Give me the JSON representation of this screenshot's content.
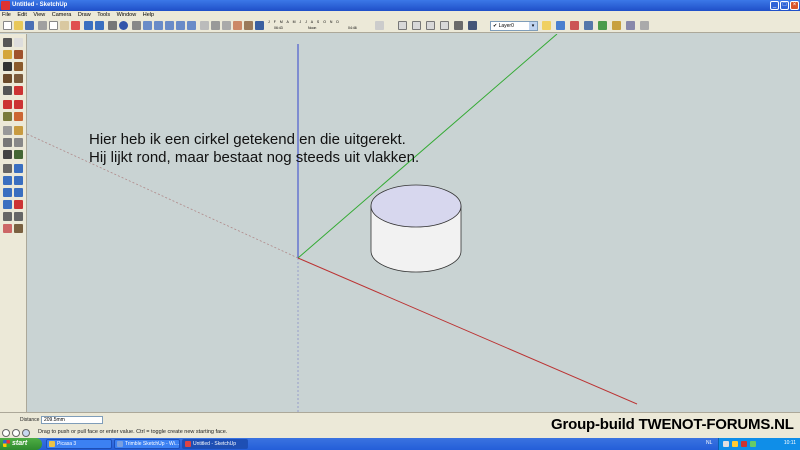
{
  "window": {
    "title": "Untitled - SketchUp",
    "buttons": {
      "minimize": "_",
      "maximize": "□",
      "close": "×"
    }
  },
  "menu": [
    "File",
    "Edit",
    "View",
    "Camera",
    "Draw",
    "Tools",
    "Window",
    "Help"
  ],
  "shadow": {
    "months": "J F M A M J J A S O N D",
    "time_early": "06:43",
    "time_noon": "Noon",
    "time_late": "04:46"
  },
  "layer": {
    "selected": "Layer0"
  },
  "annotation": {
    "line1": "Hier heb ik een cirkel getekend en die uitgerekt.",
    "line2": "Hij lijkt rond, maar bestaat nog steeds uit vlakken."
  },
  "measurements": {
    "label": "Distance",
    "value": "209.5mm"
  },
  "status": {
    "hint": "Drag to push or pull face or enter value.  Ctrl = toggle create new starting face."
  },
  "watermark": "Group-build TWENOT-FORUMS.NL",
  "taskbar": {
    "start": "start",
    "tasks": [
      "Picasa 3",
      "Trimble SketchUp - Wi...",
      "Untitled - SketchUp"
    ],
    "language": "NL",
    "clock": "10:11"
  },
  "colors": {
    "viewport_bg": "#c9d3d3",
    "axis_blue": "#3344cc",
    "axis_green": "#33aa33",
    "axis_red": "#bb3333",
    "face_top": "#d7d7ee",
    "face_side": "#f2f2f2"
  },
  "icons": [
    "select-icon",
    "eraser-icon",
    "paint-bucket-icon",
    "rectangle-icon",
    "line-icon",
    "circle-icon",
    "arc-icon",
    "polygon-icon",
    "freehand-icon",
    "move-icon",
    "push-pull-icon",
    "rotate-icon",
    "follow-me-icon",
    "scale-icon",
    "offset-icon",
    "tape-measure-icon",
    "dimension-icon",
    "protractor-icon",
    "text-icon",
    "axes-icon",
    "3d-text-icon",
    "orbit-icon",
    "pan-icon",
    "zoom-icon",
    "zoom-window-icon",
    "zoom-extents-icon",
    "previous-view-icon",
    "position-camera-icon",
    "walk-icon",
    "look-around-icon",
    "section-plane-icon",
    "sandbox-icon"
  ]
}
